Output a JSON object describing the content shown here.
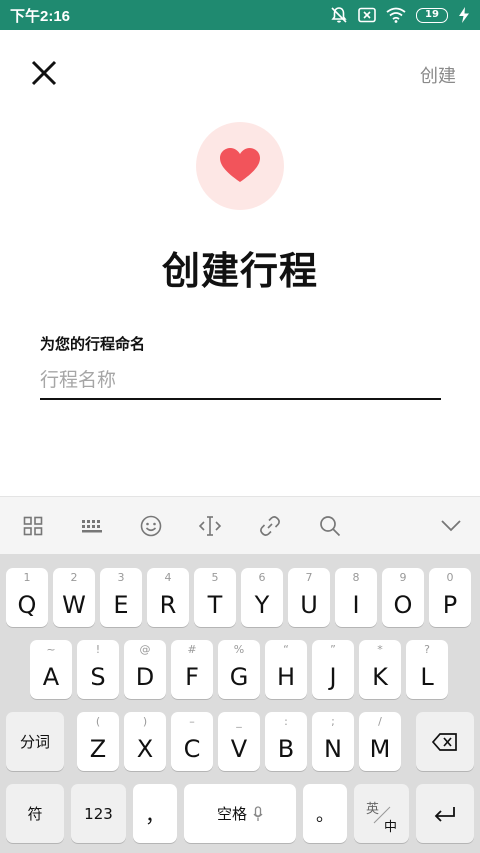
{
  "status_bar": {
    "time": "下午2:16",
    "battery": "19"
  },
  "header": {
    "create_label": "创建"
  },
  "hero": {
    "title": "创建行程",
    "accent_color": "#f2545b"
  },
  "form": {
    "label": "为您的行程命名",
    "placeholder": "行程名称",
    "value": ""
  },
  "keyboard": {
    "toolbar_icons": [
      "grid-icon",
      "keyboard-icon",
      "emoji-icon",
      "cursor-icon",
      "link-icon",
      "search-icon",
      "collapse-icon"
    ],
    "row1": [
      {
        "hint": "1",
        "key": "Q"
      },
      {
        "hint": "2",
        "key": "W"
      },
      {
        "hint": "3",
        "key": "E"
      },
      {
        "hint": "4",
        "key": "R"
      },
      {
        "hint": "5",
        "key": "T"
      },
      {
        "hint": "6",
        "key": "Y"
      },
      {
        "hint": "7",
        "key": "U"
      },
      {
        "hint": "8",
        "key": "I"
      },
      {
        "hint": "9",
        "key": "O"
      },
      {
        "hint": "0",
        "key": "P"
      }
    ],
    "row2": [
      {
        "hint": "~",
        "key": "A"
      },
      {
        "hint": "!",
        "key": "S"
      },
      {
        "hint": "@",
        "key": "D"
      },
      {
        "hint": "#",
        "key": "F"
      },
      {
        "hint": "%",
        "key": "G"
      },
      {
        "hint": "“",
        "key": "H"
      },
      {
        "hint": "”",
        "key": "J"
      },
      {
        "hint": "*",
        "key": "K"
      },
      {
        "hint": "?",
        "key": "L"
      }
    ],
    "row3": [
      {
        "hint": "(",
        "key": "Z"
      },
      {
        "hint": ")",
        "key": "X"
      },
      {
        "hint": "–",
        "key": "C"
      },
      {
        "hint": "_",
        "key": "V"
      },
      {
        "hint": ":",
        "key": "B"
      },
      {
        "hint": ";",
        "key": "N"
      },
      {
        "hint": "/",
        "key": "M"
      }
    ],
    "fenci": "分词",
    "symbols": "符",
    "numbers": "123",
    "comma": "，",
    "space": "空格",
    "period": "。",
    "lang_top": "英",
    "lang_bottom": "中"
  }
}
